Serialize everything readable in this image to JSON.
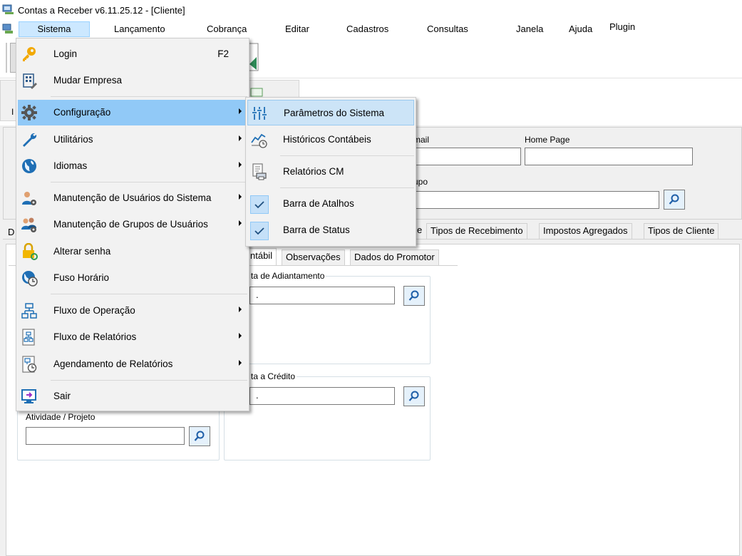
{
  "window": {
    "title": "Contas a Receber v6.11.25.12 - [Cliente]"
  },
  "menubar": {
    "items": [
      {
        "label": "Sistema"
      },
      {
        "label": "Lançamento"
      },
      {
        "label": "Cobrança"
      },
      {
        "label": "Editar"
      },
      {
        "label": "Cadastros"
      },
      {
        "label": "Consultas"
      },
      {
        "label": "Janela"
      },
      {
        "label": "Ajuda"
      },
      {
        "label": "Plugin"
      }
    ]
  },
  "sistema_menu": {
    "items": [
      {
        "label": "Login",
        "shortcut": "F2",
        "icon": "key-icon"
      },
      {
        "label": "Mudar Empresa",
        "icon": "building-icon"
      },
      {
        "label": "Configuração",
        "icon": "gear-icon"
      },
      {
        "label": "Utilitários",
        "icon": "wrench-icon"
      },
      {
        "label": "Idiomas",
        "icon": "globe-icon"
      },
      {
        "label": "Manutenção de Usuários do Sistema",
        "icon": "user-gear-icon"
      },
      {
        "label": "Manutenção de Grupos de Usuários",
        "icon": "users-gear-icon"
      },
      {
        "label": "Alterar senha",
        "icon": "lock-refresh-icon"
      },
      {
        "label": "Fuso Horário",
        "icon": "globe-clock-icon"
      },
      {
        "label": "Fluxo de Operação",
        "icon": "flowchart-icon"
      },
      {
        "label": "Fluxo de Relatórios",
        "icon": "report-flow-icon"
      },
      {
        "label": "Agendamento de Relatórios",
        "icon": "report-schedule-icon"
      },
      {
        "label": "Sair",
        "icon": "exit-monitor-icon"
      }
    ]
  },
  "config_submenu": {
    "items": [
      {
        "label": "Parâmetros do Sistema",
        "icon": "sliders-icon"
      },
      {
        "label": "Históricos Contábeis",
        "icon": "chart-clock-icon"
      },
      {
        "label": "Relatórios CM",
        "icon": "report-printer-icon"
      },
      {
        "label": "Barra de Atalhos",
        "checked": true
      },
      {
        "label": "Barra de Status",
        "checked": true
      }
    ]
  },
  "strip": {
    "label": "I"
  },
  "form": {
    "email_label": "mail",
    "homepage_label": "Home Page",
    "grupo_label": "upo",
    "dados_label": "D"
  },
  "tabs_main": [
    {
      "label": "e"
    },
    {
      "label": "Tipos de Recebimento"
    },
    {
      "label": "Impostos Agregados"
    },
    {
      "label": "Tipos de Cliente"
    }
  ],
  "tabs_sub": [
    {
      "label": "ntábil"
    },
    {
      "label": "Observações"
    },
    {
      "label": "Dados do Promotor"
    }
  ],
  "groups": {
    "adiantamento": {
      "caption": "ta de Adiantamento",
      "value": "."
    },
    "credito": {
      "caption": "ta a Crédito",
      "value": "."
    },
    "atividade": {
      "label": "Atividade / Projeto",
      "value": ""
    }
  },
  "colors": {
    "menu_highlight": "#91c9f7",
    "menubar_active": "#cce8ff",
    "submenu_highlight": "#cce4f7"
  }
}
